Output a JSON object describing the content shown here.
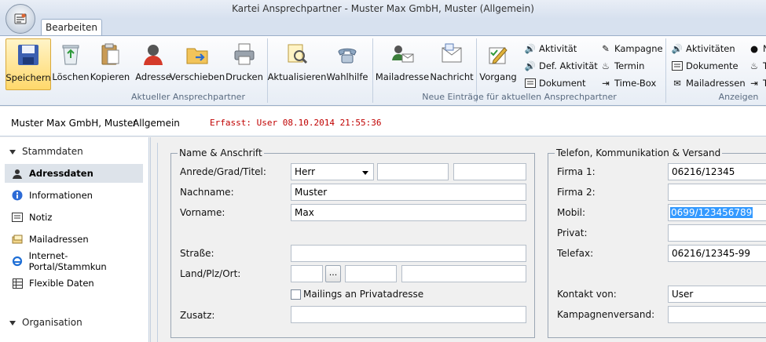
{
  "window": {
    "title": "Kartei Ansprechpartner - Muster Max GmbH, Muster (Allgemein)"
  },
  "ribbon": {
    "tab": "Bearbeiten",
    "buttons": {
      "save": "Speichern",
      "delete": "Löschen",
      "copy": "Kopieren",
      "address": "Adresse",
      "move": "Verschieben",
      "print": "Drucken",
      "refresh": "Aktualisieren",
      "dial": "Wahlhilfe",
      "mailaddress": "Mailadresse",
      "message": "Nachricht",
      "process": "Vorgang"
    },
    "small": {
      "activity": "Aktivität",
      "def_activity": "Def. Aktivität",
      "document": "Dokument",
      "campaign": "Kampagne",
      "appointment": "Termin",
      "timebox": "Time-Box",
      "activities": "Aktivitäten",
      "documents": "Dokumente",
      "mailaddresses": "Mailadressen",
      "cut_n": "N",
      "cut_t1": "T",
      "cut_t2": "T"
    },
    "groups": {
      "current": "Aktueller Ansprechpartner",
      "new_entries": "Neue Einträge für aktuellen Ansprechpartner",
      "show": "Anzeigen"
    }
  },
  "info": {
    "company": "Muster Max GmbH, Muster",
    "category": "Allgemein",
    "created": "Erfasst: User 08.10.2014 21:55:36"
  },
  "sidebar": {
    "section1": "Stammdaten",
    "items": [
      {
        "label": "Adressdaten",
        "icon": "person-card-icon"
      },
      {
        "label": "Informationen",
        "icon": "info-icon"
      },
      {
        "label": "Notiz",
        "icon": "note-icon"
      },
      {
        "label": "Mailadressen",
        "icon": "mail-stack-icon"
      },
      {
        "label": "Internet-Portal/Stammkun",
        "icon": "ie-icon"
      },
      {
        "label": "Flexible Daten",
        "icon": "table-icon"
      }
    ],
    "section2": "Organisation"
  },
  "address": {
    "legend": "Name & Anschrift",
    "salutation_label": "Anrede/Grad/Titel:",
    "salutation_value": "Herr",
    "lastname_label": "Nachname:",
    "lastname_value": "Muster",
    "firstname_label": "Vorname:",
    "firstname_value": "Max",
    "street_label": "Straße:",
    "country_label": "Land/Plz/Ort:",
    "dots": "...",
    "mailing_label": "Mailings an Privatadresse",
    "extra_label": "Zusatz:"
  },
  "contact": {
    "legend": "Telefon, Kommunikation & Versand",
    "firm1_label": "Firma 1:",
    "firm1_value": "06216/12345",
    "firm2_label": "Firma 2:",
    "mobile_label": "Mobil:",
    "mobile_value": "0699/123456789",
    "private_label": "Privat:",
    "fax_label": "Telefax:",
    "fax_value": "06216/12345-99",
    "contact_from_label": "Kontakt von:",
    "contact_from_value": "User",
    "campaign_label": "Kampagnenversand:"
  }
}
